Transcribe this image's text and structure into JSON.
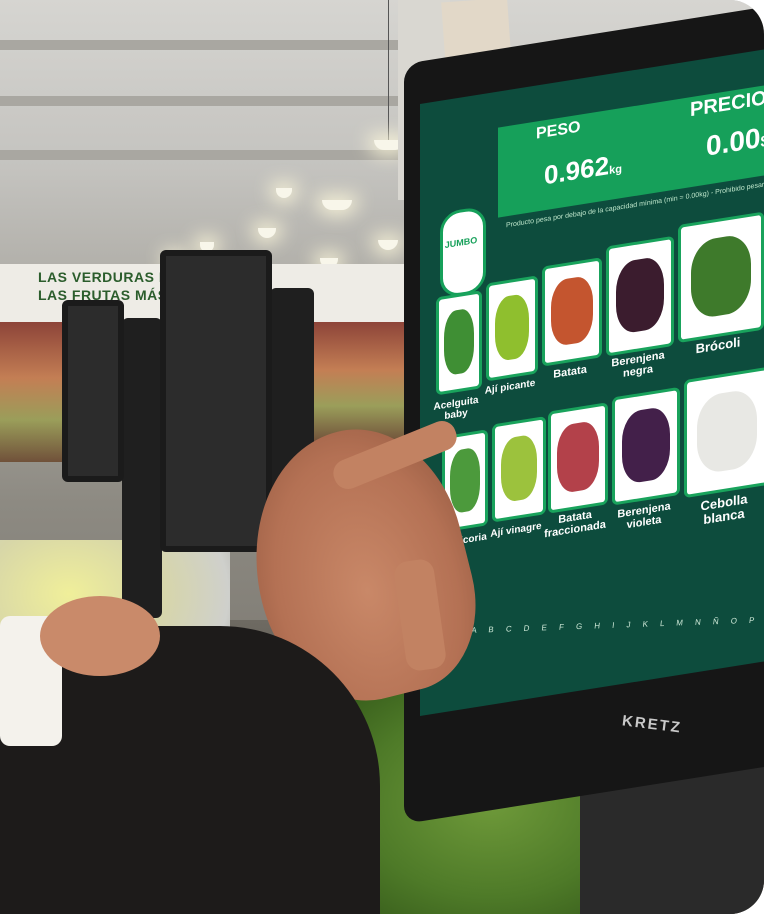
{
  "store_banner": {
    "text": "LAS VERDURAS MÁS LAS FRUTAS MÁS D"
  },
  "scale": {
    "brand": "KRETZ",
    "logo_text": "JUMBO",
    "peso_label": "PESO",
    "precio_label": "PRECIO",
    "weight_value": "0.962",
    "weight_unit": "kg",
    "price_value": "0.00",
    "price_suffix": "$",
    "note": "Producto pesa por debajo de la capacidad mínima (min = 0.00kg) - Prohibido pesar por arriba",
    "alphabet": "A B C D E F G H I J K L M N Ñ O P"
  },
  "products": [
    {
      "label": "Acelguita baby",
      "art_color": "#3f8f34"
    },
    {
      "label": "Ají picante",
      "art_color": "#8fbf2e"
    },
    {
      "label": "Batata",
      "art_color": "#c4552f"
    },
    {
      "label": "Berenjena negra",
      "art_color": "#3b1c2e"
    },
    {
      "label": "Brócoli",
      "art_color": "#3e7a2b"
    },
    {
      "label": "Achicoria",
      "art_color": "#4c9a3c"
    },
    {
      "label": "Ají vinagre",
      "art_color": "#9cc23d"
    },
    {
      "label": "Batata fraccionada",
      "art_color": "#b3414a"
    },
    {
      "label": "Berenjena violeta",
      "art_color": "#43204a"
    },
    {
      "label": "Cebolla blanca",
      "art_color": "#e8e8e4"
    }
  ]
}
